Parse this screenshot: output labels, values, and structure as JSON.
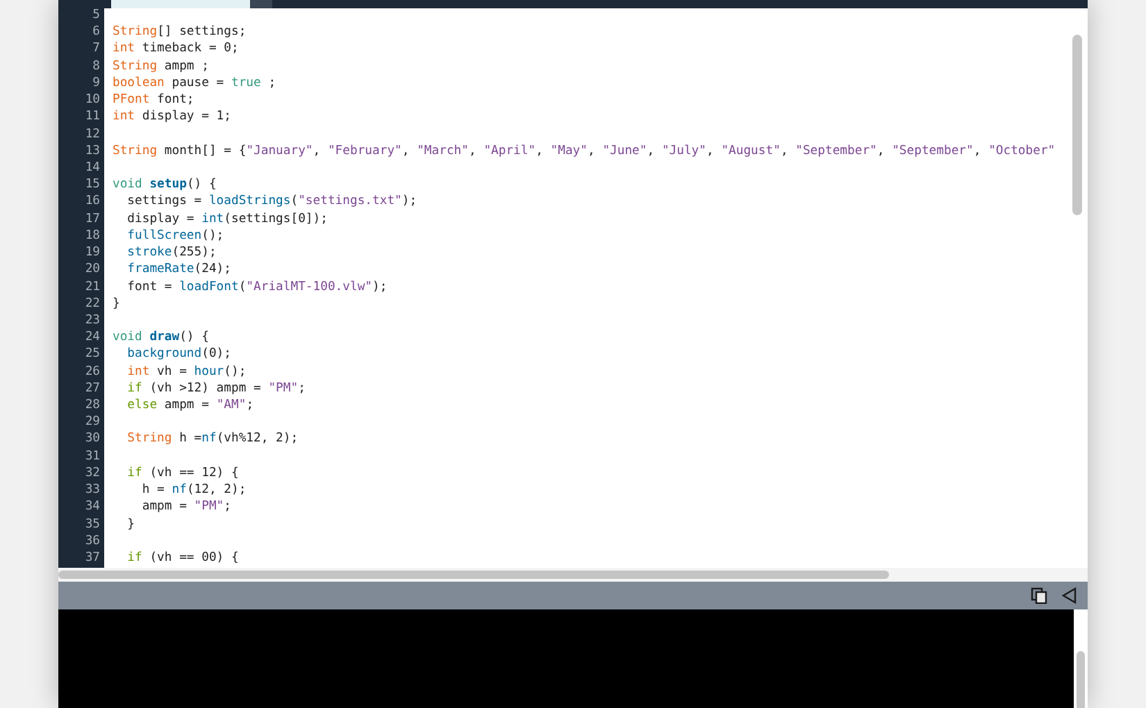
{
  "editor": {
    "lines": [
      {
        "number": "5"
      },
      {
        "number": "6",
        "tokens": [
          {
            "kind": "type",
            "text": "String"
          },
          {
            "kind": "plain",
            "text": "[] settings;"
          }
        ]
      },
      {
        "number": "7",
        "tokens": [
          {
            "kind": "type",
            "text": "int"
          },
          {
            "kind": "plain",
            "text": " timeback = 0;"
          }
        ]
      },
      {
        "number": "8",
        "tokens": [
          {
            "kind": "type",
            "text": "String"
          },
          {
            "kind": "plain",
            "text": " ampm ;"
          }
        ]
      },
      {
        "number": "9",
        "tokens": [
          {
            "kind": "type",
            "text": "boolean"
          },
          {
            "kind": "plain",
            "text": " pause = "
          },
          {
            "kind": "literal",
            "text": "true"
          },
          {
            "kind": "plain",
            "text": " ;"
          }
        ]
      },
      {
        "number": "10",
        "tokens": [
          {
            "kind": "type",
            "text": "PFont"
          },
          {
            "kind": "plain",
            "text": " font;"
          }
        ]
      },
      {
        "number": "11",
        "tokens": [
          {
            "kind": "type",
            "text": "int"
          },
          {
            "kind": "plain",
            "text": " display = 1;"
          }
        ]
      },
      {
        "number": "12"
      },
      {
        "number": "13",
        "tokens": [
          {
            "kind": "type",
            "text": "String"
          },
          {
            "kind": "plain",
            "text": " month[] = {"
          },
          {
            "kind": "string",
            "text": "\"January\""
          },
          {
            "kind": "plain",
            "text": ", "
          },
          {
            "kind": "string",
            "text": "\"February\""
          },
          {
            "kind": "plain",
            "text": ", "
          },
          {
            "kind": "string",
            "text": "\"March\""
          },
          {
            "kind": "plain",
            "text": ", "
          },
          {
            "kind": "string",
            "text": "\"April\""
          },
          {
            "kind": "plain",
            "text": ", "
          },
          {
            "kind": "string",
            "text": "\"May\""
          },
          {
            "kind": "plain",
            "text": ", "
          },
          {
            "kind": "string",
            "text": "\"June\""
          },
          {
            "kind": "plain",
            "text": ", "
          },
          {
            "kind": "string",
            "text": "\"July\""
          },
          {
            "kind": "plain",
            "text": ", "
          },
          {
            "kind": "string",
            "text": "\"August\""
          },
          {
            "kind": "plain",
            "text": ", "
          },
          {
            "kind": "string",
            "text": "\"September\""
          },
          {
            "kind": "plain",
            "text": ", "
          },
          {
            "kind": "string",
            "text": "\"September\""
          },
          {
            "kind": "plain",
            "text": ", "
          },
          {
            "kind": "string",
            "text": "\"October\""
          }
        ]
      },
      {
        "number": "14"
      },
      {
        "number": "15",
        "tokens": [
          {
            "kind": "literal",
            "text": "void"
          },
          {
            "kind": "funcdef",
            "text": " setup"
          },
          {
            "kind": "plain",
            "text": "() {"
          }
        ]
      },
      {
        "number": "16",
        "tokens": [
          {
            "kind": "plain",
            "text": "  settings = "
          },
          {
            "kind": "func",
            "text": "loadStrings"
          },
          {
            "kind": "plain",
            "text": "("
          },
          {
            "kind": "string",
            "text": "\"settings.txt\""
          },
          {
            "kind": "plain",
            "text": ");"
          }
        ]
      },
      {
        "number": "17",
        "tokens": [
          {
            "kind": "plain",
            "text": "  display = "
          },
          {
            "kind": "func",
            "text": "int"
          },
          {
            "kind": "plain",
            "text": "(settings[0]);"
          }
        ]
      },
      {
        "number": "18",
        "tokens": [
          {
            "kind": "func",
            "text": "  fullScreen"
          },
          {
            "kind": "plain",
            "text": "();"
          }
        ]
      },
      {
        "number": "19",
        "tokens": [
          {
            "kind": "func",
            "text": "  stroke"
          },
          {
            "kind": "plain",
            "text": "(255);"
          }
        ]
      },
      {
        "number": "20",
        "tokens": [
          {
            "kind": "func",
            "text": "  frameRate"
          },
          {
            "kind": "plain",
            "text": "(24);"
          }
        ]
      },
      {
        "number": "21",
        "tokens": [
          {
            "kind": "plain",
            "text": "  font = "
          },
          {
            "kind": "func",
            "text": "loadFont"
          },
          {
            "kind": "plain",
            "text": "("
          },
          {
            "kind": "string",
            "text": "\"ArialMT-100.vlw\""
          },
          {
            "kind": "plain",
            "text": ");"
          }
        ]
      },
      {
        "number": "22",
        "tokens": [
          {
            "kind": "plain",
            "text": "}"
          }
        ]
      },
      {
        "number": "23"
      },
      {
        "number": "24",
        "tokens": [
          {
            "kind": "literal",
            "text": "void"
          },
          {
            "kind": "funcdef",
            "text": " draw"
          },
          {
            "kind": "plain",
            "text": "() {"
          }
        ]
      },
      {
        "number": "25",
        "tokens": [
          {
            "kind": "func",
            "text": "  background"
          },
          {
            "kind": "plain",
            "text": "(0);"
          }
        ]
      },
      {
        "number": "26",
        "tokens": [
          {
            "kind": "type",
            "text": "  int"
          },
          {
            "kind": "plain",
            "text": " vh = "
          },
          {
            "kind": "func",
            "text": "hour"
          },
          {
            "kind": "plain",
            "text": "();"
          }
        ]
      },
      {
        "number": "27",
        "tokens": [
          {
            "kind": "control",
            "text": "  if"
          },
          {
            "kind": "plain",
            "text": " (vh >12) ampm = "
          },
          {
            "kind": "string",
            "text": "\"PM\""
          },
          {
            "kind": "plain",
            "text": ";"
          }
        ]
      },
      {
        "number": "28",
        "tokens": [
          {
            "kind": "control",
            "text": "  else"
          },
          {
            "kind": "plain",
            "text": " ampm = "
          },
          {
            "kind": "string",
            "text": "\"AM\""
          },
          {
            "kind": "plain",
            "text": ";"
          }
        ]
      },
      {
        "number": "29"
      },
      {
        "number": "30",
        "tokens": [
          {
            "kind": "type",
            "text": "  String"
          },
          {
            "kind": "plain",
            "text": " h ="
          },
          {
            "kind": "func",
            "text": "nf"
          },
          {
            "kind": "plain",
            "text": "(vh%12, 2);"
          }
        ]
      },
      {
        "number": "31"
      },
      {
        "number": "32",
        "tokens": [
          {
            "kind": "control",
            "text": "  if"
          },
          {
            "kind": "plain",
            "text": " (vh == 12) {"
          }
        ]
      },
      {
        "number": "33",
        "tokens": [
          {
            "kind": "plain",
            "text": "    h = "
          },
          {
            "kind": "func",
            "text": "nf"
          },
          {
            "kind": "plain",
            "text": "(12, 2);"
          }
        ]
      },
      {
        "number": "34",
        "tokens": [
          {
            "kind": "plain",
            "text": "    ampm = "
          },
          {
            "kind": "string",
            "text": "\"PM\""
          },
          {
            "kind": "plain",
            "text": ";"
          }
        ]
      },
      {
        "number": "35",
        "tokens": [
          {
            "kind": "plain",
            "text": "  }"
          }
        ]
      },
      {
        "number": "36"
      },
      {
        "number": "37",
        "tokens": [
          {
            "kind": "control",
            "text": "  if"
          },
          {
            "kind": "plain",
            "text": " (vh == 00) {"
          }
        ]
      }
    ]
  }
}
